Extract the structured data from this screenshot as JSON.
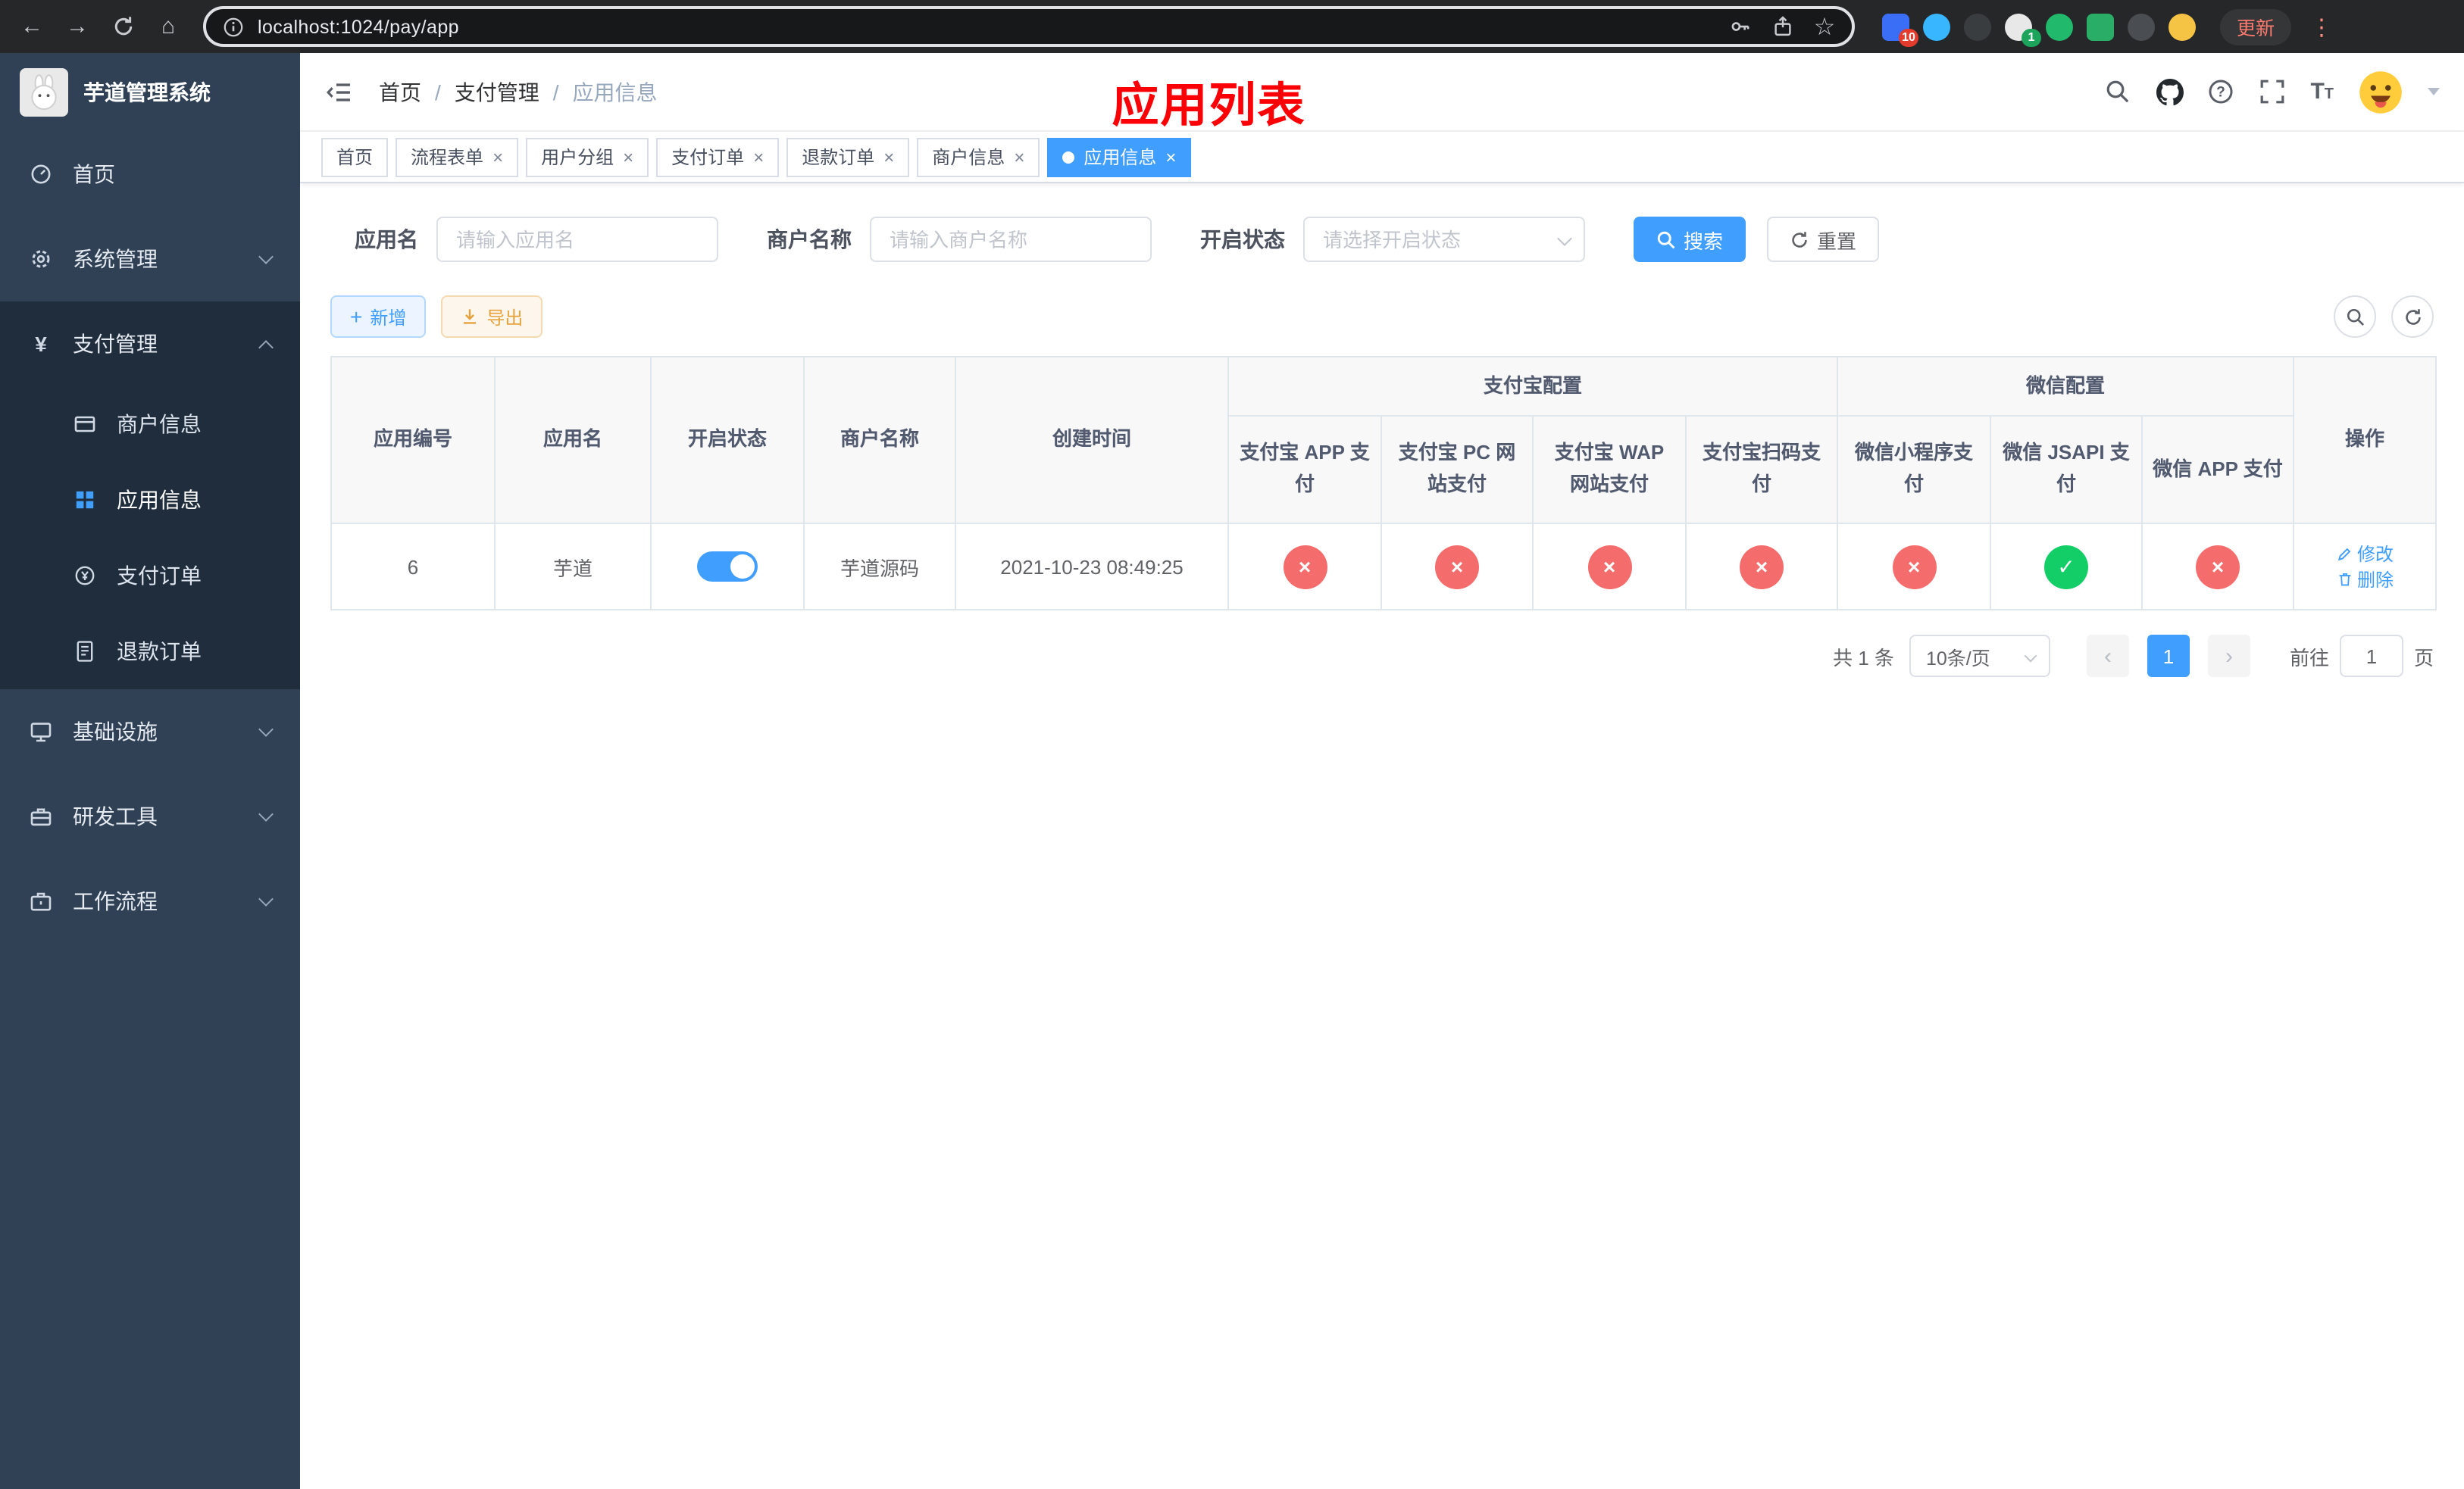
{
  "browser": {
    "url": "localhost:1024/pay/app",
    "update_label": "更新",
    "extension_badges": {
      "puzzle": "10",
      "profile": "1"
    }
  },
  "sidebar": {
    "title": "芋道管理系统",
    "items": [
      {
        "label": "首页"
      },
      {
        "label": "系统管理"
      },
      {
        "label": "支付管理",
        "children": [
          {
            "label": "商户信息"
          },
          {
            "label": "应用信息"
          },
          {
            "label": "支付订单"
          },
          {
            "label": "退款订单"
          }
        ]
      },
      {
        "label": "基础设施"
      },
      {
        "label": "研发工具"
      },
      {
        "label": "工作流程"
      }
    ]
  },
  "header": {
    "breadcrumb": [
      "首页",
      "支付管理",
      "应用信息"
    ],
    "annotation": "应用列表"
  },
  "tabs": [
    {
      "label": "首页"
    },
    {
      "label": "流程表单"
    },
    {
      "label": "用户分组"
    },
    {
      "label": "支付订单"
    },
    {
      "label": "退款订单"
    },
    {
      "label": "商户信息"
    },
    {
      "label": "应用信息"
    }
  ],
  "filters": {
    "app_name": {
      "label": "应用名",
      "placeholder": "请输入应用名"
    },
    "merchant_name": {
      "label": "商户名称",
      "placeholder": "请输入商户名称"
    },
    "status": {
      "label": "开启状态",
      "placeholder": "请选择开启状态"
    },
    "search_label": "搜索",
    "reset_label": "重置"
  },
  "toolbar": {
    "add_label": "新增",
    "export_label": "导出"
  },
  "table": {
    "headers": [
      "应用编号",
      "应用名",
      "开启状态",
      "商户名称",
      "创建时间"
    ],
    "groups": [
      {
        "label": "支付宝配置",
        "children": [
          "支付宝 APP 支付",
          "支付宝 PC 网站支付",
          "支付宝 WAP 网站支付",
          "支付宝扫码支付"
        ]
      },
      {
        "label": "微信配置",
        "children": [
          "微信小程序支付",
          "微信 JSAPI 支付",
          "微信 APP 支付"
        ]
      }
    ],
    "action_header": "操作",
    "rows": [
      {
        "id": "6",
        "name": "芋道",
        "enabled": true,
        "merchant": "芋道源码",
        "created_at": "2021-10-23 08:49:25",
        "pay_statuses": [
          "no",
          "no",
          "no",
          "no",
          "no",
          "yes",
          "no"
        ],
        "actions": {
          "edit": "修改",
          "delete": "删除"
        }
      }
    ]
  },
  "pagination": {
    "total": "共 1 条",
    "page_size": "10条/页",
    "current_page": "1",
    "goto_label": "前往",
    "goto_value": "1",
    "goto_suffix": "页"
  },
  "colors": {
    "accent": "#409eff",
    "success": "#13ce66",
    "danger": "#f56c6c"
  }
}
